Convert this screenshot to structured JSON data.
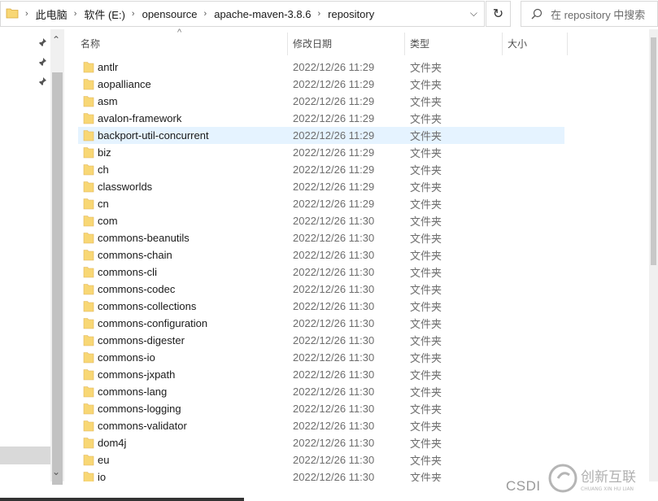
{
  "address": {
    "crumbs": [
      "此电脑",
      "软件 (E:)",
      "opensource",
      "apache-maven-3.8.6",
      "repository"
    ]
  },
  "search": {
    "placeholder": "在 repository 中搜索"
  },
  "columns": {
    "name": "名称",
    "date": "修改日期",
    "type": "类型",
    "size": "大小"
  },
  "rows": [
    {
      "name": "antlr",
      "date": "2022/12/26 11:29",
      "type": "文件夹"
    },
    {
      "name": "aopalliance",
      "date": "2022/12/26 11:29",
      "type": "文件夹"
    },
    {
      "name": "asm",
      "date": "2022/12/26 11:29",
      "type": "文件夹"
    },
    {
      "name": "avalon-framework",
      "date": "2022/12/26 11:29",
      "type": "文件夹"
    },
    {
      "name": "backport-util-concurrent",
      "date": "2022/12/26 11:29",
      "type": "文件夹"
    },
    {
      "name": "biz",
      "date": "2022/12/26 11:29",
      "type": "文件夹"
    },
    {
      "name": "ch",
      "date": "2022/12/26 11:29",
      "type": "文件夹"
    },
    {
      "name": "classworlds",
      "date": "2022/12/26 11:29",
      "type": "文件夹"
    },
    {
      "name": "cn",
      "date": "2022/12/26 11:29",
      "type": "文件夹"
    },
    {
      "name": "com",
      "date": "2022/12/26 11:30",
      "type": "文件夹"
    },
    {
      "name": "commons-beanutils",
      "date": "2022/12/26 11:30",
      "type": "文件夹"
    },
    {
      "name": "commons-chain",
      "date": "2022/12/26 11:30",
      "type": "文件夹"
    },
    {
      "name": "commons-cli",
      "date": "2022/12/26 11:30",
      "type": "文件夹"
    },
    {
      "name": "commons-codec",
      "date": "2022/12/26 11:30",
      "type": "文件夹"
    },
    {
      "name": "commons-collections",
      "date": "2022/12/26 11:30",
      "type": "文件夹"
    },
    {
      "name": "commons-configuration",
      "date": "2022/12/26 11:30",
      "type": "文件夹"
    },
    {
      "name": "commons-digester",
      "date": "2022/12/26 11:30",
      "type": "文件夹"
    },
    {
      "name": "commons-io",
      "date": "2022/12/26 11:30",
      "type": "文件夹"
    },
    {
      "name": "commons-jxpath",
      "date": "2022/12/26 11:30",
      "type": "文件夹"
    },
    {
      "name": "commons-lang",
      "date": "2022/12/26 11:30",
      "type": "文件夹"
    },
    {
      "name": "commons-logging",
      "date": "2022/12/26 11:30",
      "type": "文件夹"
    },
    {
      "name": "commons-validator",
      "date": "2022/12/26 11:30",
      "type": "文件夹"
    },
    {
      "name": "dom4j",
      "date": "2022/12/26 11:30",
      "type": "文件夹"
    },
    {
      "name": "eu",
      "date": "2022/12/26 11:30",
      "type": "文件夹"
    },
    {
      "name": "io",
      "date": "2022/12/26 11:30",
      "type": "文件夹"
    }
  ],
  "hovered_row": "backport-util-concurrent",
  "colors": {
    "folder": "#f8d775",
    "hover": "#e5f3ff",
    "text_secondary": "#6d6d6d"
  },
  "watermark": {
    "csdn": "CSDI",
    "logo_text": "创新互联",
    "logo_sub": "CHUANG XIN HU LIAN"
  }
}
